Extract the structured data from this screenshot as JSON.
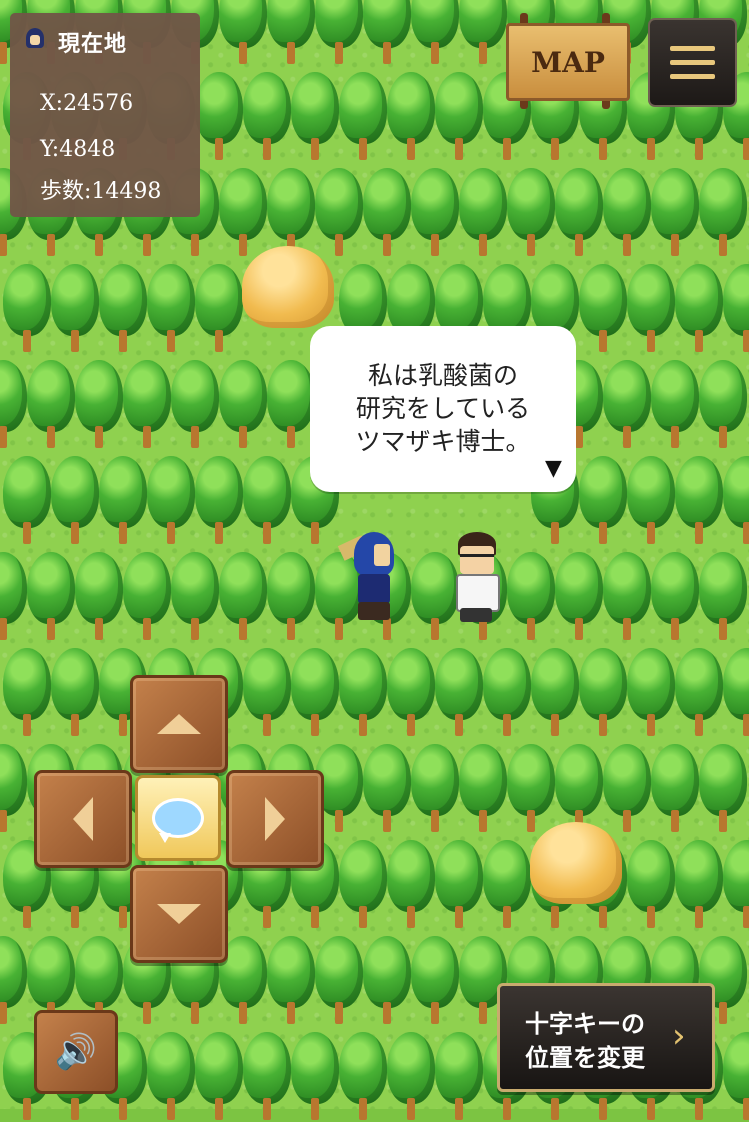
{
  "status": {
    "title": "現在地",
    "x_line": "X:24576",
    "y_line": "Y:4848",
    "steps_line": "歩数:14498"
  },
  "map_button": {
    "label": "MAP"
  },
  "dialog": {
    "lines": [
      "私は乳酸菌の",
      "研究をしている",
      "ツマザキ博士。"
    ],
    "more_glyph": "▼"
  },
  "controls": {
    "change_dpad_line1": "十字キーの",
    "change_dpad_line2": "位置を変更",
    "chevron": "›",
    "sound_glyph": "🔊"
  }
}
